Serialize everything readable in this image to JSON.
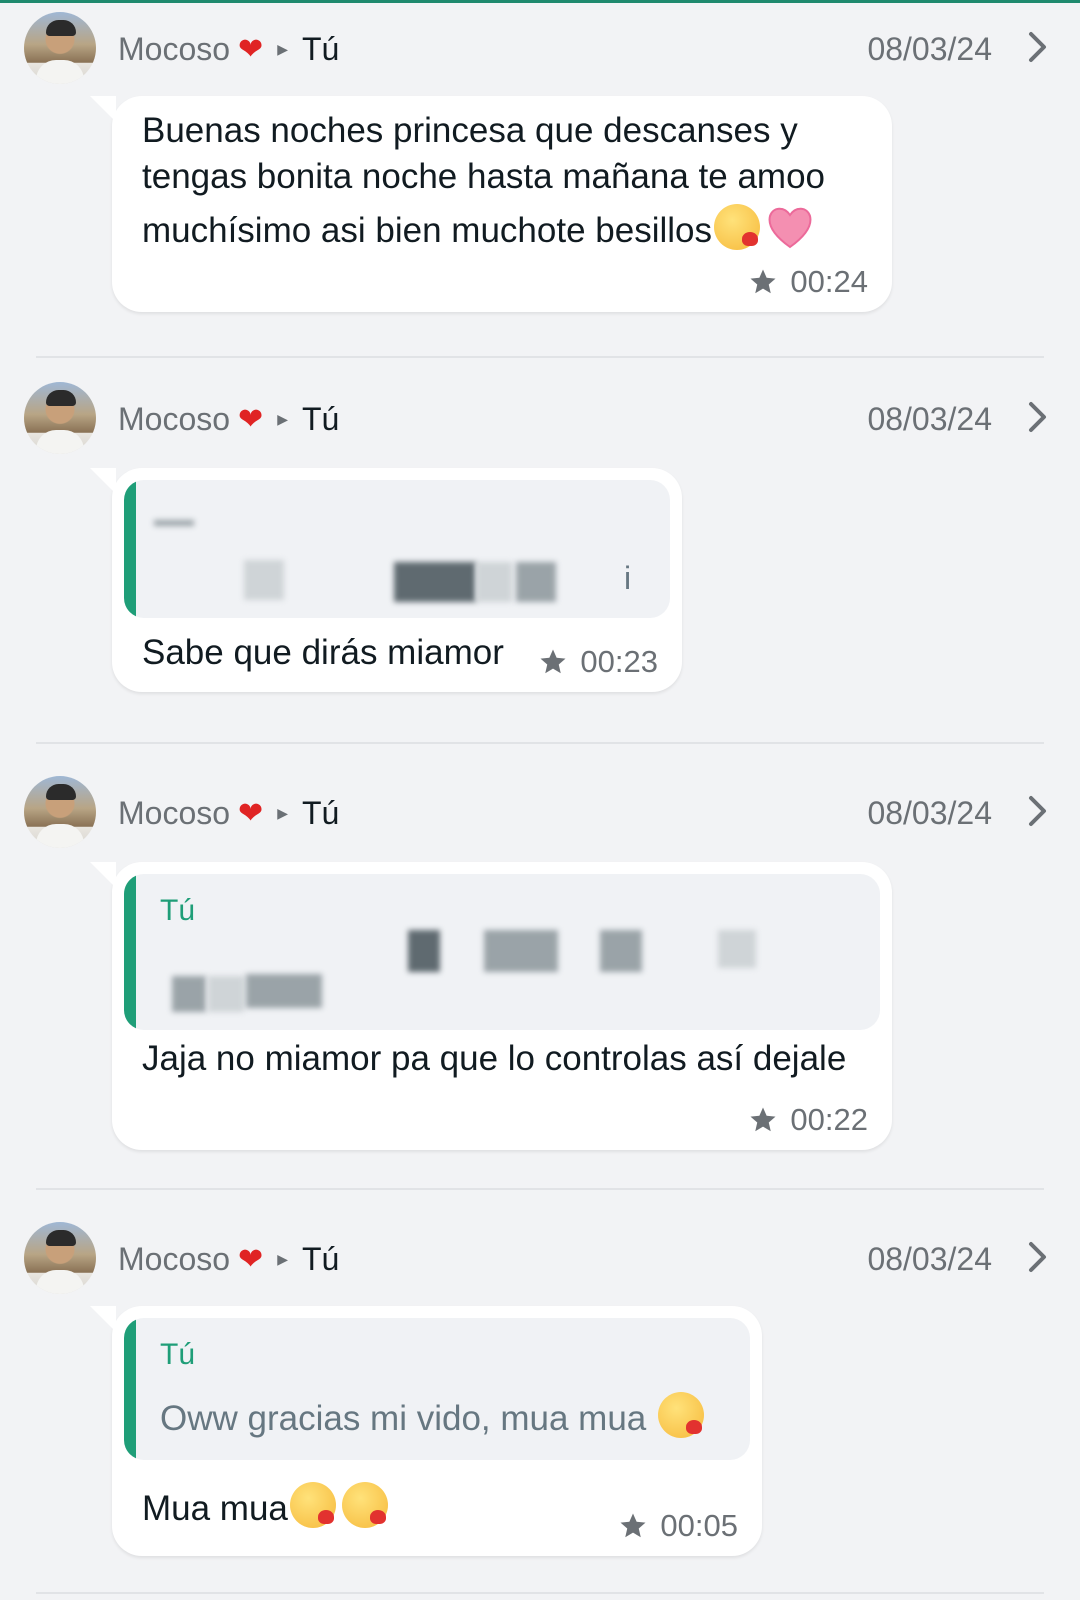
{
  "colors": {
    "accent": "#1f9e78",
    "topbar": "#1f8a6e",
    "heart": "#e02424"
  },
  "messages": [
    {
      "sender": "Mocoso",
      "sender_emoji": "heart-icon",
      "recipient": "Tú",
      "date": "08/03/24",
      "text_lines": [
        "Buenas noches princesa que descanses y",
        "tengas bonita noche hasta mañana te amoo",
        "muchísimo asi bien muchote besillos"
      ],
      "time": "00:24"
    },
    {
      "sender": "Mocoso",
      "recipient": "Tú",
      "date": "08/03/24",
      "quote": {
        "name": "Tú",
        "text": "i"
      },
      "text": "Sabe que dirás miamor",
      "time": "00:23"
    },
    {
      "sender": "Mocoso",
      "recipient": "Tú",
      "date": "08/03/24",
      "quote": {
        "name": "Tú",
        "text": ""
      },
      "text": "Jaja no miamor pa que lo controlas así dejale",
      "time": "00:22"
    },
    {
      "sender": "Mocoso",
      "recipient": "Tú",
      "date": "08/03/24",
      "quote": {
        "name": "Tú",
        "text": "Oww gracias mi vido, mua mua"
      },
      "text": "Mua mua",
      "time": "00:05"
    }
  ]
}
